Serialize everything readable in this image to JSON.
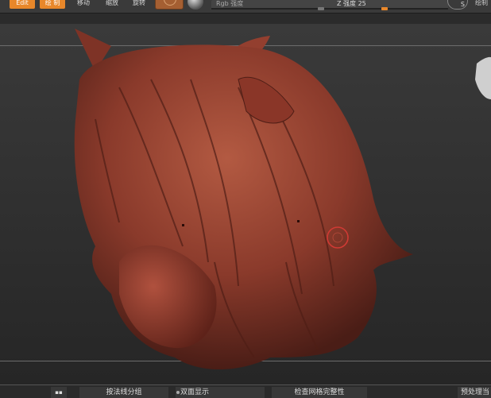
{
  "toolbar": {
    "edit_label": "Edit",
    "draw_label": "绘 制",
    "move_label": "移动",
    "scale_label": "缩放",
    "rotate_label": "旋转",
    "rgb_label": "Rgb 强度",
    "z_label": "Z 强度",
    "z_value": "25",
    "z_fraction": 0.25,
    "s_label": "S",
    "cut_label": "绘制"
  },
  "bottom_bar": {
    "group_by_normals": "按法线分组",
    "double_sided": "双面显示",
    "check_mesh": "检查网格完整性",
    "preprocess": "预处理当"
  },
  "colors": {
    "accent": "#e8872a",
    "model": "#8c3a2c",
    "brush_ring": "#d03a34"
  },
  "icons": {
    "material": "material-swatch-icon",
    "sphere": "sphere-icon",
    "brush": "brush-cursor-icon"
  }
}
